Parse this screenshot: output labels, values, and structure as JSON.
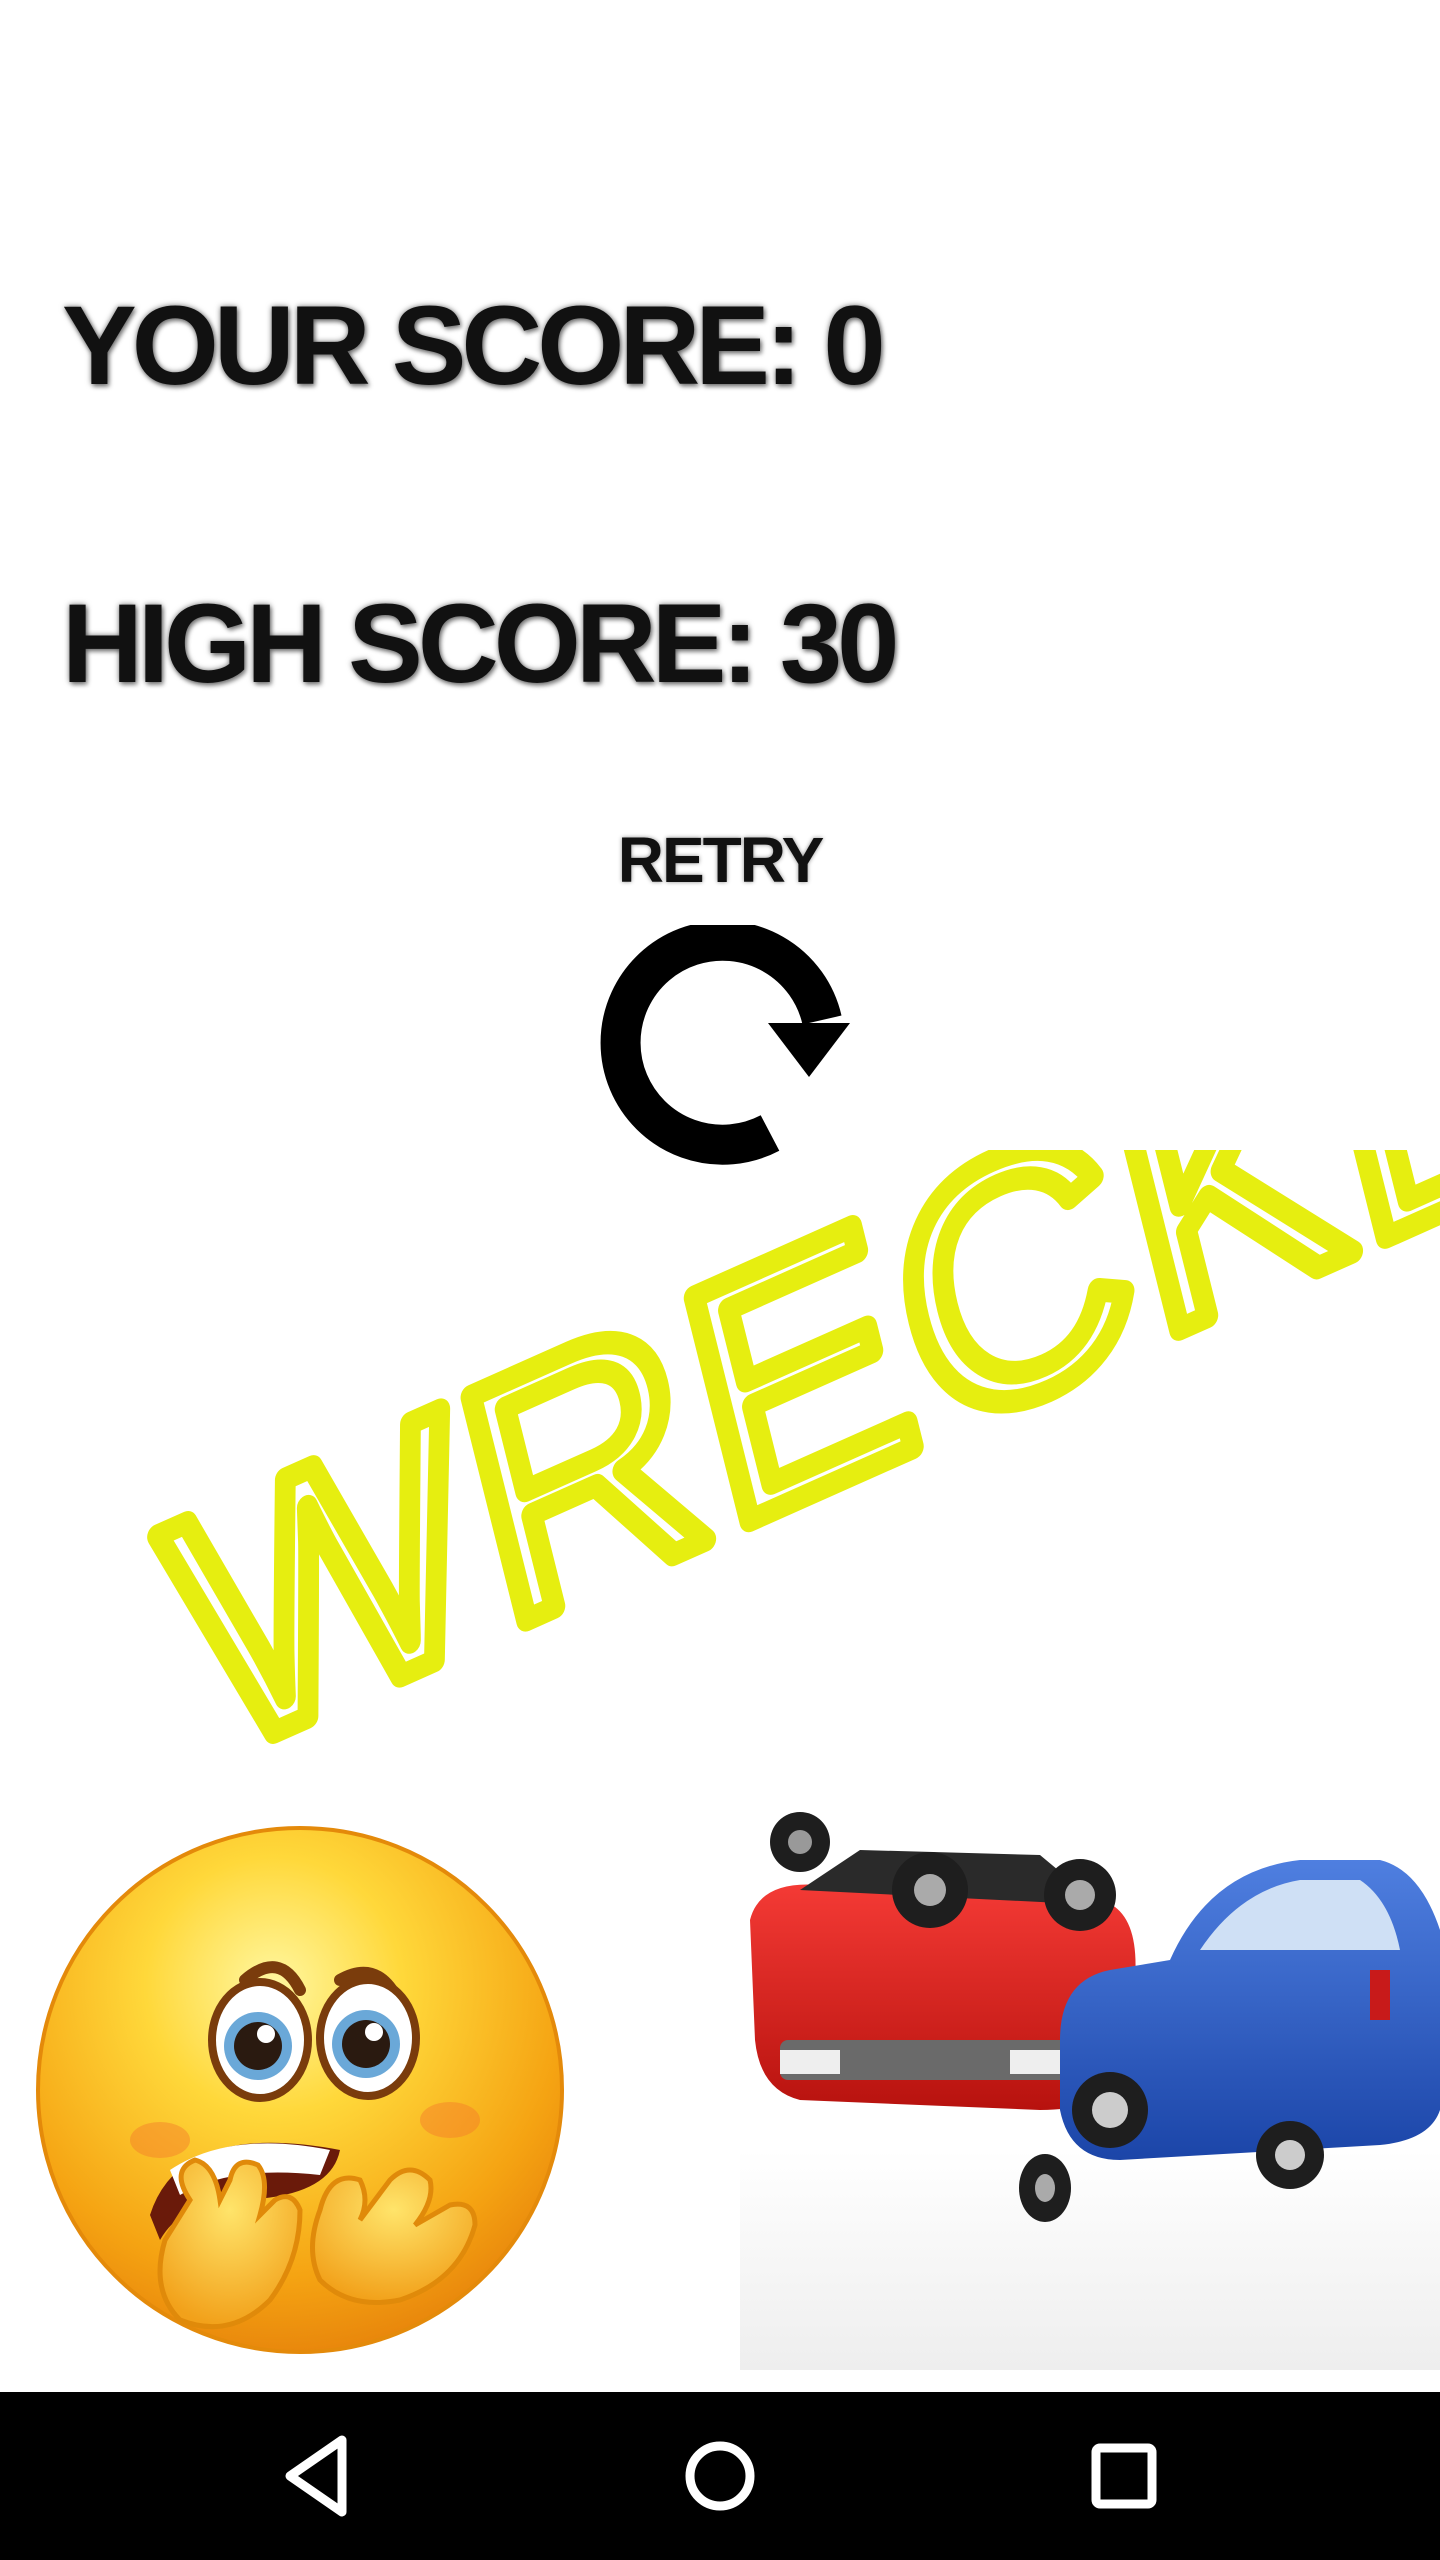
{
  "scores": {
    "your_score": "YOUR SCORE: 0",
    "high_score": "HIGH SCORE: 30"
  },
  "retry": {
    "label": "RETRY",
    "icon": "retry-icon"
  },
  "banner": {
    "text": "WRECKED",
    "color": "#e6ee10"
  },
  "images": {
    "emoji": "worried-emoji",
    "crash": "car-crash"
  },
  "navbar": {
    "back_icon": "back-icon",
    "home_icon": "home-icon",
    "recents_icon": "recents-icon"
  },
  "colors": {
    "background": "#ffffff",
    "text": "#111111",
    "navbar": "#000000",
    "accent": "#e6ee10"
  }
}
